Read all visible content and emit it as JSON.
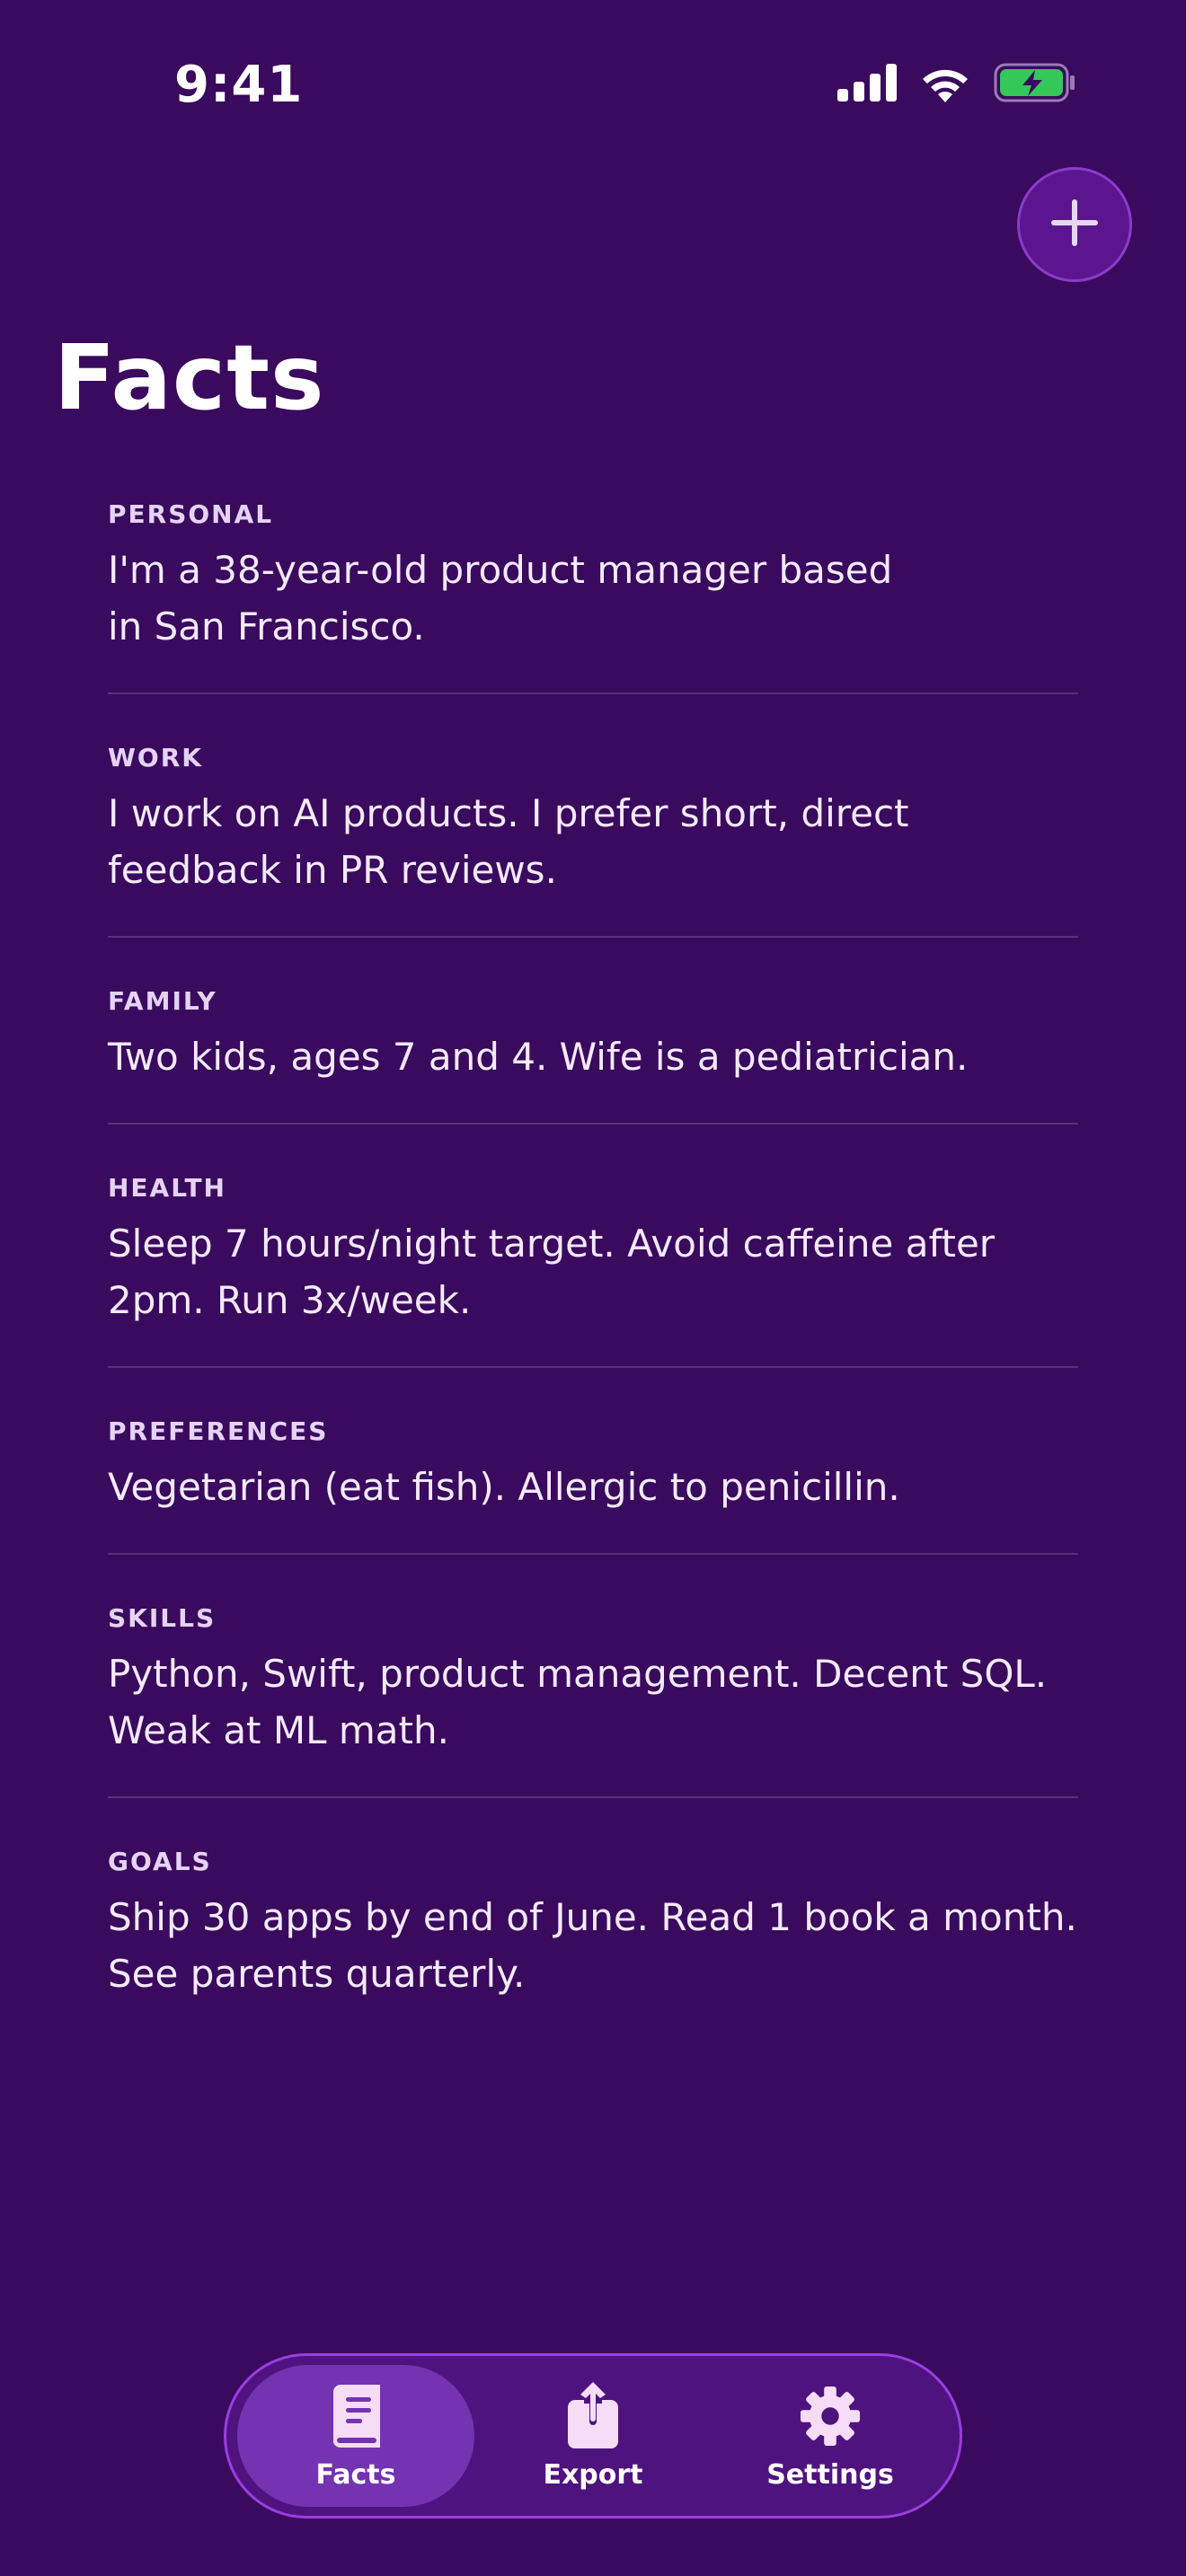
{
  "status_bar": {
    "time": "9:41"
  },
  "header": {
    "title": "Facts",
    "add_icon": "plus-icon"
  },
  "facts": [
    {
      "category": "PERSONAL",
      "text": "I'm a 38-year-old product manager based in San Francisco."
    },
    {
      "category": "WORK",
      "text": "I work on AI products. I prefer short, direct feedback in PR reviews."
    },
    {
      "category": "FAMILY",
      "text": "Two kids, ages 7 and 4. Wife is a pediatrician."
    },
    {
      "category": "HEALTH",
      "text": "Sleep 7 hours/night target. Avoid caffeine after 2pm. Run 3x/week."
    },
    {
      "category": "PREFERENCES",
      "text": "Vegetarian (eat fish). Allergic to penicillin."
    },
    {
      "category": "SKILLS",
      "text": "Python, Swift, product management. Decent SQL. Weak at ML math."
    },
    {
      "category": "GOALS",
      "text": "Ship 30 apps by end of June. Read 1 book a month. See parents quarterly."
    }
  ],
  "tab_bar": {
    "tabs": [
      {
        "label": "Facts",
        "icon": "book-icon",
        "active": true
      },
      {
        "label": "Export",
        "icon": "share-icon",
        "active": false
      },
      {
        "label": "Settings",
        "icon": "gear-icon",
        "active": false
      }
    ]
  },
  "colors": {
    "background": "#3a0a5e",
    "accent": "#9a3ee0",
    "battery": "#34c759"
  }
}
